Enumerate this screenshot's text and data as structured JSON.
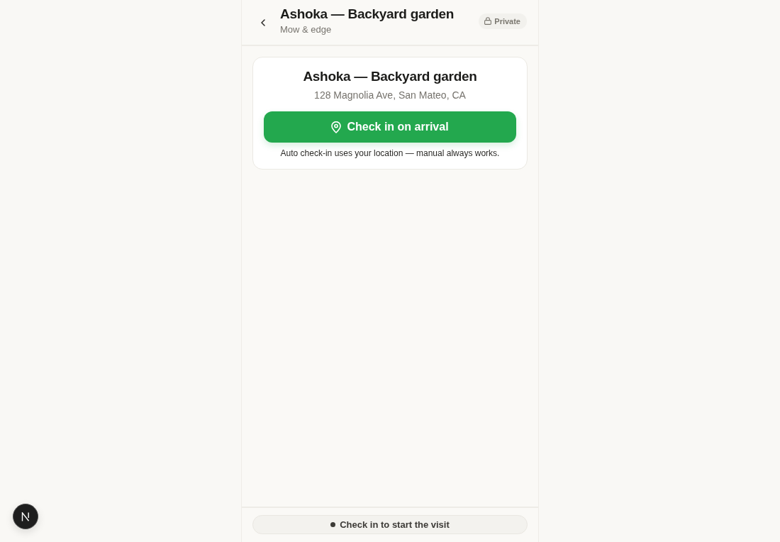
{
  "header": {
    "title": "Ashoka — Backyard garden",
    "subtitle": "Mow & edge",
    "visibility_badge": {
      "label": "Private"
    }
  },
  "site_card": {
    "title": "Ashoka — Backyard garden",
    "address": "128 Magnolia Ave, San Mateo, CA",
    "check_in_button": {
      "label": "Check in on arrival"
    },
    "note": "Auto check-in uses your location — manual always works."
  },
  "status_bar": {
    "label": "Check in to start the visit"
  }
}
